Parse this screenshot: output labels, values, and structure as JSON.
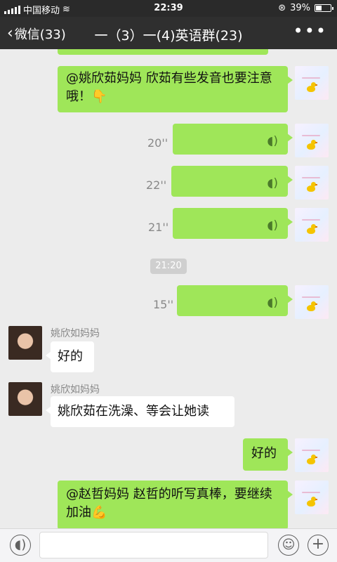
{
  "status_bar": {
    "carrier": "中国移动",
    "time": "22:39",
    "battery": "39%",
    "battery_level": 0.39
  },
  "nav": {
    "back_label": "微信(33)",
    "title": "一（3）一(4)英语群(23)",
    "more_icon": "more-icon"
  },
  "messages": {
    "m1_text": "@姚欣茹妈妈 欣茹有些发音也要注意哦！👇",
    "v1_duration": "20''",
    "v2_duration": "22''",
    "v3_duration": "21''",
    "timestamp": "21:20",
    "v4_duration": "15''",
    "sender_name_1": "姚欣如妈妈",
    "m2_text": "好的",
    "sender_name_2": "姚欣如妈妈",
    "m3_text": "姚欣茹在洗澡、等会让她读",
    "m4_text": "好的",
    "m5_text": "@赵哲妈妈 赵哲的听写真棒，要继续加油💪"
  },
  "input_bar": {
    "voice_icon": "voice-mode-icon",
    "emoji_icon": "emoji-icon",
    "plus_icon": "plus-icon",
    "value": ""
  }
}
